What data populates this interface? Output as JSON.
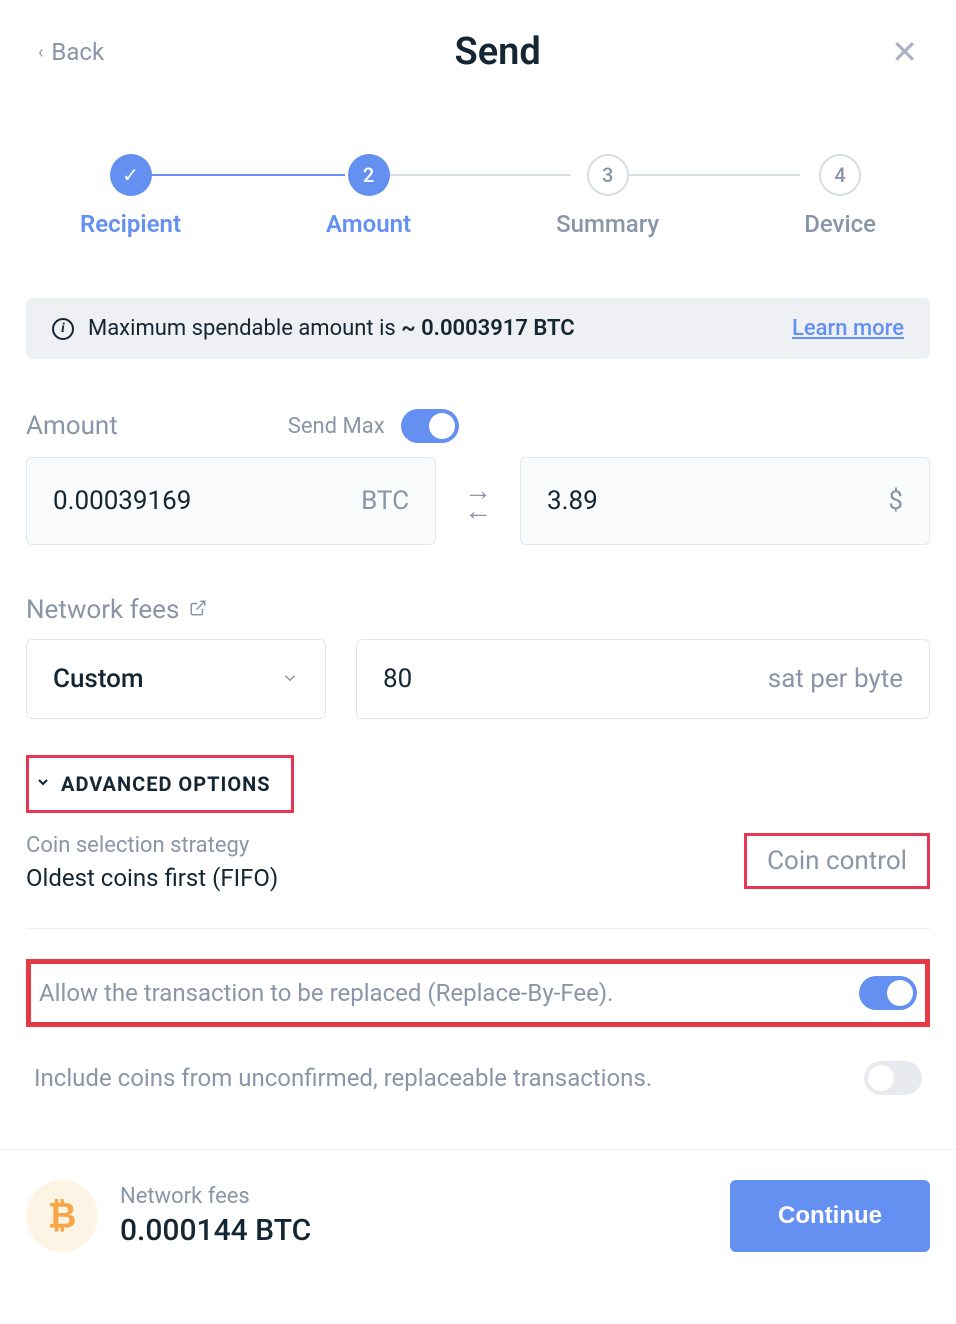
{
  "header": {
    "back": "Back",
    "title": "Send"
  },
  "stepper": {
    "s1": {
      "label": "Recipient"
    },
    "s2": {
      "num": "2",
      "label": "Amount"
    },
    "s3": {
      "num": "3",
      "label": "Summary"
    },
    "s4": {
      "num": "4",
      "label": "Device"
    }
  },
  "info": {
    "prefix": "Maximum spendable amount is ",
    "amount": "~ 0.0003917 BTC",
    "learn": "Learn more"
  },
  "amount": {
    "label": "Amount",
    "sendmax": "Send Max",
    "crypto_val": "0.00039169",
    "crypto_unit": "BTC",
    "fiat_val": "3.89",
    "fiat_unit": "$"
  },
  "fees": {
    "label": "Network fees",
    "dropdown": "Custom",
    "value": "80",
    "unit": "sat per byte"
  },
  "advanced": {
    "toggle_label": "ADVANCED OPTIONS",
    "strategy_label": "Coin selection strategy",
    "strategy_value": "Oldest coins first (FIFO)",
    "coin_control": "Coin control",
    "rbf_text": "Allow the transaction to be replaced (Replace-By-Fee).",
    "unconfirmed_text": "Include coins from unconfirmed, replaceable transactions."
  },
  "footer": {
    "nf_label": "Network fees",
    "nf_value": "0.000144 BTC",
    "continue": "Continue"
  }
}
